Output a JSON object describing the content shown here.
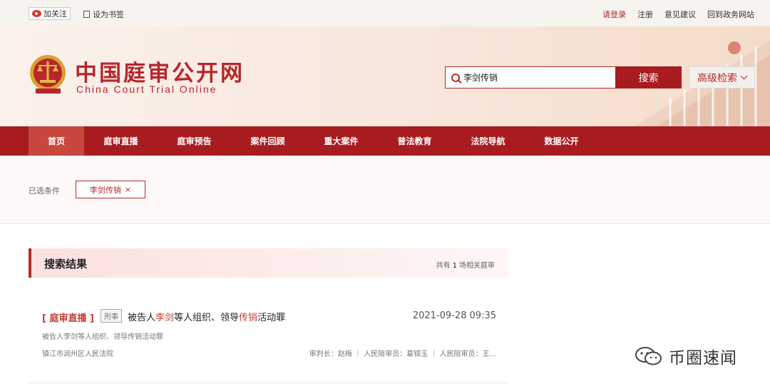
{
  "topbar": {
    "follow_label": "加关注",
    "bookmark_label": "设为书签",
    "links": [
      "请登录",
      "注册",
      "意见建议",
      "回到政务网站"
    ]
  },
  "header": {
    "site_title": "中国庭审公开网",
    "site_subtitle": "China Court Trial Online",
    "search_value": "李剑传销",
    "search_button": "搜索",
    "advanced_search": "高级检索"
  },
  "nav": {
    "items": [
      "首页",
      "庭审直播",
      "庭审预告",
      "案件回顾",
      "重大案件",
      "普法教育",
      "法院导航",
      "数据公开"
    ],
    "active_index": 0
  },
  "filter": {
    "label": "已选条件",
    "chip": "李剑传销",
    "chip_remove": "×"
  },
  "results": {
    "title": "搜索结果",
    "count_prefix": "共有",
    "count": "1",
    "count_suffix": "场相关庭审",
    "items": [
      {
        "tag": "[ 庭审直播 ]",
        "badge": "刑事",
        "title_parts": [
          "被告人",
          "李剑",
          "等人组织、领导",
          "传销",
          "活动罪"
        ],
        "time": "2021-09-28 09:35",
        "desc": "被告人李剑等人组织、领导传销活动罪",
        "court": "镇江市润州区人民法院",
        "judges": "审判长：赵梅 ｜ 人民陪审员：葛锦玉 ｜ 人民陪审员：王..."
      }
    ]
  },
  "watermark": {
    "text": "币圈速闻"
  },
  "colors": {
    "brand_red": "#a81c20",
    "highlight": "#c53e33"
  }
}
